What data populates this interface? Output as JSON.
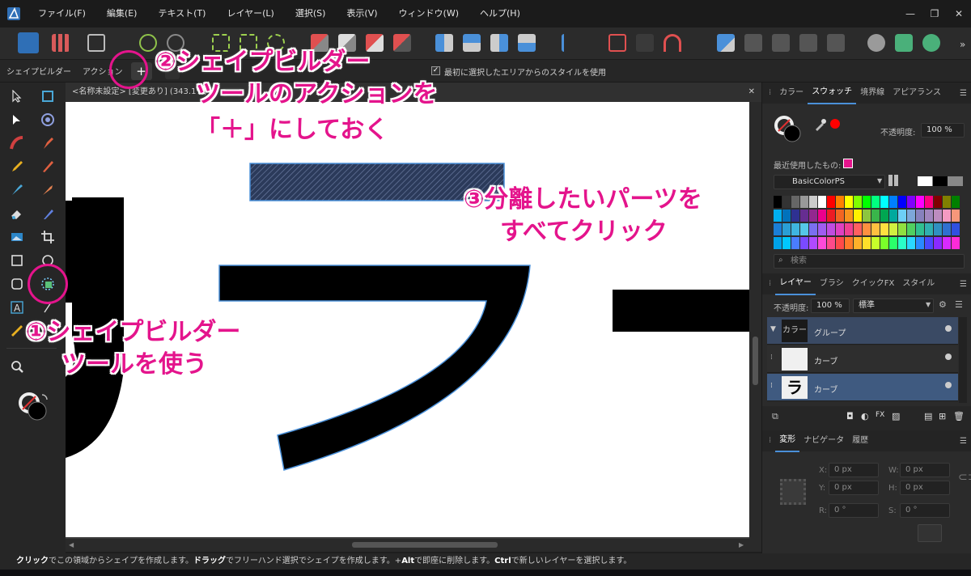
{
  "menu": {
    "items": [
      "ファイル(F)",
      "編集(E)",
      "テキスト(T)",
      "レイヤー(L)",
      "選択(S)",
      "表示(V)",
      "ウィンドウ(W)",
      "ヘルプ(H)"
    ]
  },
  "context_bar": {
    "tool_name": "シェイプビルダー",
    "action_label": "アクション",
    "add_button": "+",
    "option_label": "最初に選択したエリアからのスタイルを使用"
  },
  "document": {
    "tab_title": "<名称未設定> [変更あり] (343.1%)"
  },
  "swatches_panel": {
    "tabs": [
      "カラー",
      "スウォッチ",
      "境界線",
      "アピアランス"
    ],
    "active_tab": "スウォッチ",
    "opacity_label": "不透明度:",
    "opacity_value": "100 %",
    "recent_label": "最近使用したもの:",
    "palette_name": "BasicColorPS",
    "search_placeholder": "検索",
    "recent_color": "#e4148c"
  },
  "layers_panel": {
    "tabs": [
      "レイヤー",
      "ブラシ",
      "クイックFX",
      "スタイル"
    ],
    "active_tab": "レイヤー",
    "opacity_label": "不透明度:",
    "opacity_value": "100 %",
    "blend_mode": "標準",
    "rows": [
      {
        "thumb": "カラー",
        "name": "グループ"
      },
      {
        "thumb": "",
        "name": "カーブ"
      },
      {
        "thumb": "ラ",
        "name": "カーブ"
      }
    ]
  },
  "transform_panel": {
    "tabs": [
      "変形",
      "ナビゲータ",
      "履歴"
    ],
    "active_tab": "変形",
    "x_label": "X:",
    "x_value": "0 px",
    "y_label": "Y:",
    "y_value": "0 px",
    "w_label": "W:",
    "w_value": "0 px",
    "h_label": "H:",
    "h_value": "0 px",
    "r_label": "R:",
    "r_value": "0 °",
    "s_label": "S:",
    "s_value": "0 °"
  },
  "status_bar": {
    "click_key": "クリック",
    "click_text": "でこの領域からシェイプを作成します。",
    "drag_key": "ドラッグ",
    "drag_text": "でフリーハンド選択でシェイプを作成します。+",
    "alt_key": "Alt",
    "alt_text": "で即座に削除します。",
    "ctrl_key": "Ctrl",
    "ctrl_text": "で新しいレイヤーを選択します。"
  },
  "annotations": {
    "step1_line1": "①シェイプビルダー",
    "step1_line2": "ツールを使う",
    "step2_line1": "②シェイプビルダー",
    "step2_line2": "ツールのアクションを",
    "step2_line3": "「＋」にしておく",
    "step3_line1": "③分離したいパーツを",
    "step3_line2": "すべてクリック",
    "color": "#e4148c"
  }
}
